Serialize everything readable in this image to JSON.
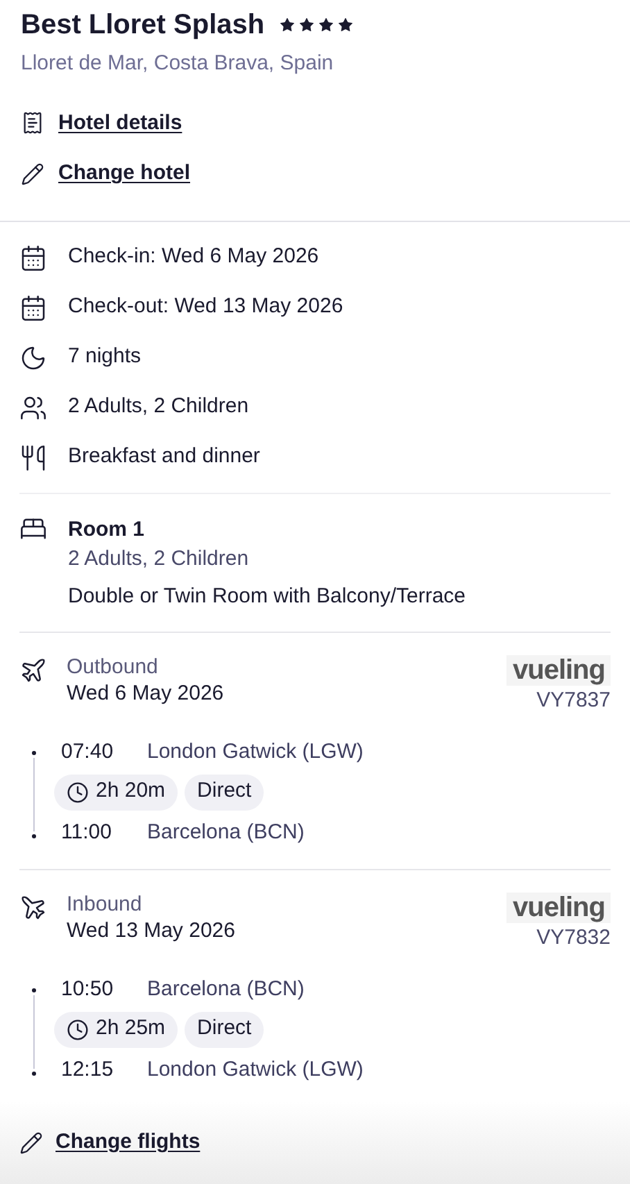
{
  "hotel": {
    "name": "Best Lloret Splash",
    "stars": 4,
    "location": "Lloret de Mar, Costa Brava, Spain"
  },
  "hotel_links": [
    {
      "kind": "details",
      "label": "Hotel details"
    },
    {
      "kind": "change",
      "label": "Change hotel"
    }
  ],
  "details": [
    {
      "kind": "checkin",
      "text": "Check-in: Wed 6 May 2026"
    },
    {
      "kind": "checkout",
      "text": "Check-out: Wed 13 May 2026"
    },
    {
      "kind": "nights",
      "text": "7 nights"
    },
    {
      "kind": "guests",
      "text": "2 Adults, 2 Children"
    },
    {
      "kind": "board",
      "text": "Breakfast and dinner"
    }
  ],
  "rooms": [
    {
      "title": "Room 1",
      "guests": "2 Adults, 2 Children",
      "type": "Double or Twin Room with Balcony/Terrace"
    }
  ],
  "flights": [
    {
      "kind": "outbound",
      "label": "Outbound",
      "date": "Wed 6 May 2026",
      "airline": "vueling",
      "number": "VY7837",
      "depart_time": "07:40",
      "depart_airport": "London Gatwick (LGW)",
      "duration": "2h 20m",
      "stops": "Direct",
      "arrive_time": "11:00",
      "arrive_airport": "Barcelona (BCN)"
    },
    {
      "kind": "inbound",
      "label": "Inbound",
      "date": "Wed 13 May 2026",
      "airline": "vueling",
      "number": "VY7832",
      "depart_time": "10:50",
      "depart_airport": "Barcelona (BCN)",
      "duration": "2h 25m",
      "stops": "Direct",
      "arrive_time": "12:15",
      "arrive_airport": "London Gatwick (LGW)"
    }
  ],
  "change_flights": "Change flights"
}
